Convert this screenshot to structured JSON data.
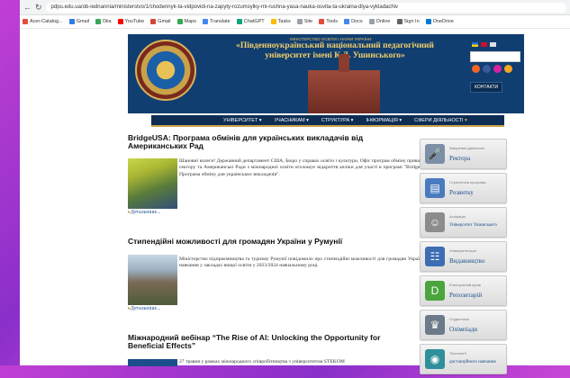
{
  "browser": {
    "url": "pdpu.edu.ua/ob-iednannia/ministerstvo/1/shodennyk-ta-vidpovidi-na-zapyty-rozumsylky-mi-rushna-yasa-nauka-osvita-ta-ukraina-dlya-vykladachiv",
    "bookmarks": [
      "Acer-Catalog...",
      "Gmail",
      "Diia",
      "YouTube",
      "Gmail",
      "Maps",
      "Translate",
      "ChatGPT",
      "Tasks",
      "Site",
      "Tools",
      "Docs",
      "Online",
      "Sign In",
      "OneDrive"
    ]
  },
  "header": {
    "ministry": "МІНІСТЕРСТВО ОСВІТИ І НАУКИ УКРАЇНИ",
    "title": "«Південноукраїнський національний педагогічний університет імені К.Д. Ушинського»",
    "contacts": "КОНТАКТИ"
  },
  "menu": [
    "УНІВЕРСИТЕТ",
    "УЧАСНИКАМ",
    "СТРУКТУРА",
    "ІНФОРМАЦІЯ",
    "СФЕРИ ДІЯЛЬНОСТІ"
  ],
  "articles": [
    {
      "title": "BridgeUSA: Програма обмінів для українських викладачів від Американських Рад",
      "text": "Шановні колеги! Державний департамент США, Бюро у справах освіти і культури, Офіс програм обміну приватного сектору та Американські Ради з міжнародної освіти оголошує відкриття апліки для участі в програмі \"BridgeUSA: Програма обміну для українських викладачів\".",
      "more": "Детальніше..."
    },
    {
      "title": "Стипендійні можливості для громадян України у Румунії",
      "text": "Міністерство підприємництва та туризму Румунії повідомило про стипендійні можливості для громадян України на навчання у закладах вищої освіти у 2023/2024 навчальному році.",
      "more": "Детальніше..."
    },
    {
      "title": "Міжнародний вебінар “The Rise of AI: Unlocking the Opportunity for Beneficial Effects”",
      "text": "27 травня у рамках міжнародного співробітництва з університетом STEKOM",
      "more": ""
    }
  ],
  "sidebar": [
    {
      "small": "Зміцнення діяльності",
      "big": "Ректора",
      "icon": "microphone-icon",
      "color": "#7d8fa6"
    },
    {
      "small": "Стратегічна програма",
      "big": "Розвитку",
      "icon": "chart-icon",
      "color": "#4a7bbf"
    },
    {
      "small": "Асоціація",
      "big": "Університет Ушинського",
      "icon": "people-icon",
      "color": "#8c8c8c"
    },
    {
      "small": "Університетське",
      "big": "Видавництво",
      "icon": "book-icon",
      "color": "#3d6eb3"
    },
    {
      "small": "Електронний архів",
      "big": "Репозитарій",
      "icon": "d-logo-icon",
      "color": "#4aa53c"
    },
    {
      "small": "Студентські",
      "big": "Олімпіади",
      "icon": "trophy-icon",
      "color": "#6c7a8a"
    },
    {
      "small": "Технології",
      "big": "дистанційного навчання",
      "icon": "globe-icon",
      "color": "#2f8f9a"
    }
  ]
}
